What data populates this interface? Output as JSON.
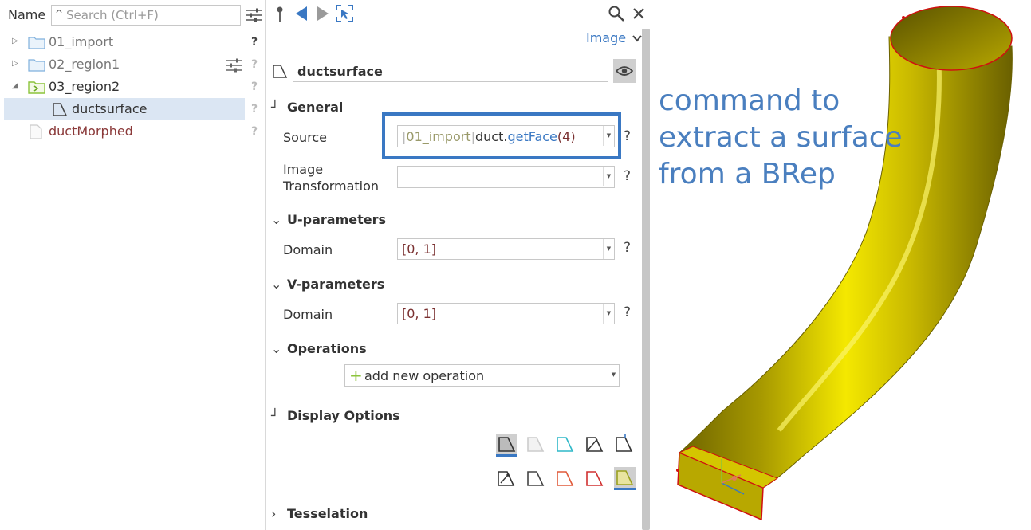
{
  "tree": {
    "header_label": "Name",
    "search_placeholder": "Search (Ctrl+F)",
    "items": [
      {
        "label": "01_import",
        "help": "?"
      },
      {
        "label": "02_region1",
        "help": "?"
      },
      {
        "label": "03_region2",
        "help": "?"
      },
      {
        "label": "ductsurface",
        "help": "?"
      },
      {
        "label": "ductMorphed",
        "help": "?"
      }
    ]
  },
  "props": {
    "view_mode": "Image",
    "object_name": "ductsurface",
    "sections": {
      "general": "General",
      "u_params": "U-parameters",
      "v_params": "V-parameters",
      "operations": "Operations",
      "display": "Display Options",
      "tesselation": "Tesselation"
    },
    "source_label": "Source",
    "source_prefix": "01_import",
    "source_object": "duct",
    "source_dot": ".",
    "source_method": "getFace",
    "source_args": "(4)",
    "image_transformation_label_1": "Image",
    "image_transformation_label_2": "Transformation",
    "image_transformation_value": "",
    "u_domain_label": "Domain",
    "u_domain_value": "[0, 1]",
    "v_domain_label": "Domain",
    "v_domain_value": "[0, 1]",
    "add_operation": "add new operation",
    "help": "?"
  },
  "annotation": {
    "line1": "command to",
    "line2": "extract a surface",
    "line3": "from a BRep"
  },
  "colors": {
    "accent_blue": "#3a78c3",
    "annotation_blue": "#4a7fbf",
    "surface_yellow": "#d4c400",
    "edge_red": "#d01010",
    "morphed_label": "#8b3a3a"
  }
}
